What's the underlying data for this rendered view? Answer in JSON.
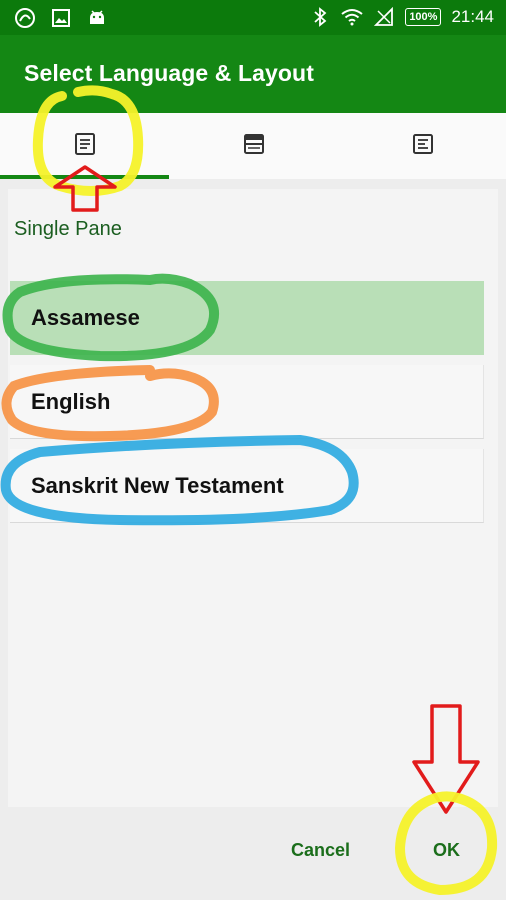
{
  "status_bar": {
    "time": "21:44",
    "battery": "100%",
    "icons": [
      "app-logo-icon",
      "image-icon",
      "android-icon",
      "bluetooth-icon",
      "wifi-icon",
      "no-sim-icon",
      "battery-icon"
    ]
  },
  "toolbar": {
    "title": "Select Language & Layout"
  },
  "tabs": [
    {
      "icon": "single-pane-icon"
    },
    {
      "icon": "split-pane-icon"
    },
    {
      "icon": "verse-layout-icon"
    }
  ],
  "selected_tab_name": "Single Pane",
  "languages": [
    {
      "label": "Assamese",
      "selected": true
    },
    {
      "label": "English",
      "selected": false
    },
    {
      "label": "Sanskrit New Testament",
      "selected": false
    }
  ],
  "buttons": {
    "cancel": "Cancel",
    "ok": "OK"
  },
  "colors": {
    "status_bar": "#0c7a0c",
    "toolbar": "#148714",
    "selected_row": "#b9dfb7",
    "accent_text": "#1b6e1b",
    "annotation_yellow": "#f6f22a",
    "annotation_red": "#e21b1b",
    "annotation_green": "#3cb44b",
    "annotation_orange": "#f7964a",
    "annotation_blue": "#2aa8e0"
  }
}
